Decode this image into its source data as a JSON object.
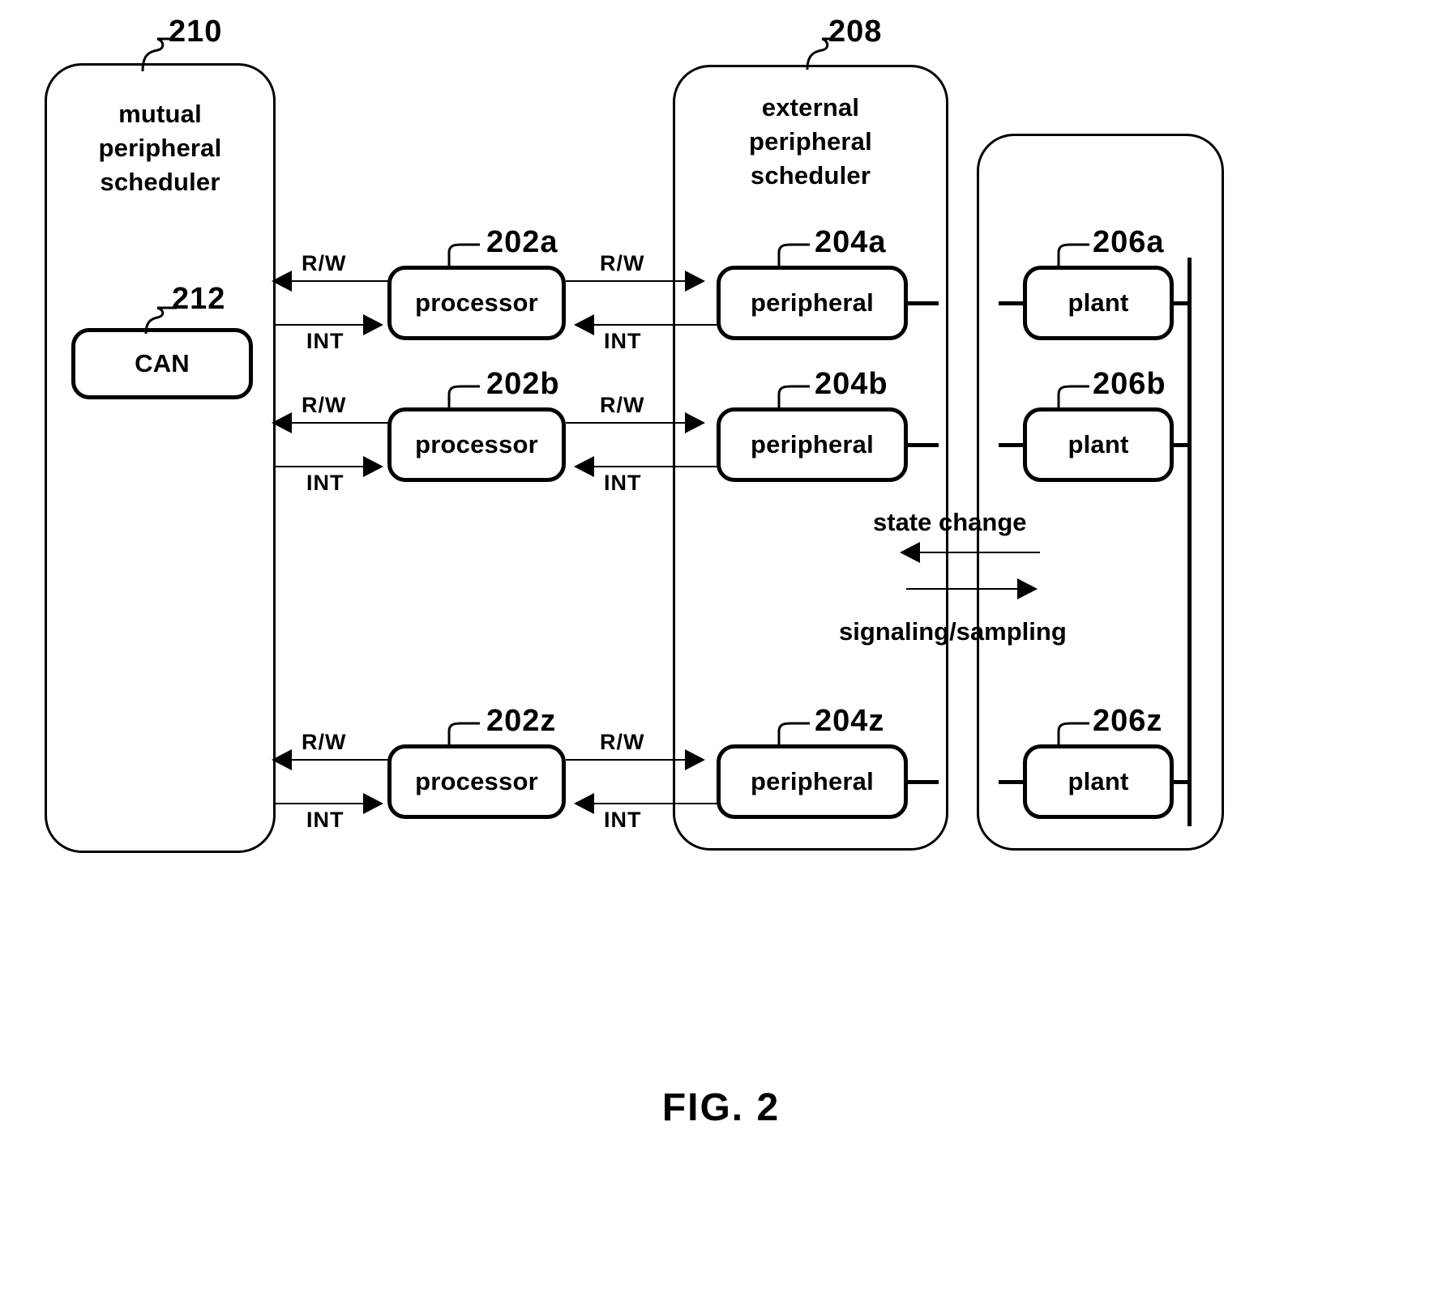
{
  "figure": {
    "caption": "FIG. 2"
  },
  "groups": [
    {
      "id": "mutual-peripheral-scheduler",
      "ref": "210",
      "title": "mutual\nperipheral\nscheduler",
      "title_lines": [
        "mutual",
        "peripheral",
        "scheduler"
      ]
    },
    {
      "id": "external-peripheral-scheduler",
      "ref": "208",
      "title": "external\nperipheral\nscheduler",
      "title_lines": [
        "external",
        "peripheral",
        "scheduler"
      ]
    },
    {
      "id": "plant-group",
      "ref": "",
      "title": "",
      "title_lines": []
    }
  ],
  "can": {
    "label": "CAN",
    "ref": "212"
  },
  "rows": [
    {
      "processor": {
        "label": "processor",
        "ref": "202a"
      },
      "peripheral": {
        "label": "peripheral",
        "ref": "204a"
      },
      "plant": {
        "label": "plant",
        "ref": "206a"
      },
      "signals": {
        "left_rw": "R/W",
        "left_int": "INT",
        "right_rw": "R/W",
        "right_int": "INT"
      }
    },
    {
      "processor": {
        "label": "processor",
        "ref": "202b"
      },
      "peripheral": {
        "label": "peripheral",
        "ref": "204b"
      },
      "plant": {
        "label": "plant",
        "ref": "206b"
      },
      "signals": {
        "left_rw": "R/W",
        "left_int": "INT",
        "right_rw": "R/W",
        "right_int": "INT"
      }
    },
    {
      "processor": {
        "label": "processor",
        "ref": "202z"
      },
      "peripheral": {
        "label": "peripheral",
        "ref": "204z"
      },
      "plant": {
        "label": "plant",
        "ref": "206z"
      },
      "signals": {
        "left_rw": "R/W",
        "left_int": "INT",
        "right_rw": "R/W",
        "right_int": "INT"
      }
    }
  ],
  "legend": {
    "state_change": "state change",
    "signaling_sampling": "signaling/sampling"
  }
}
